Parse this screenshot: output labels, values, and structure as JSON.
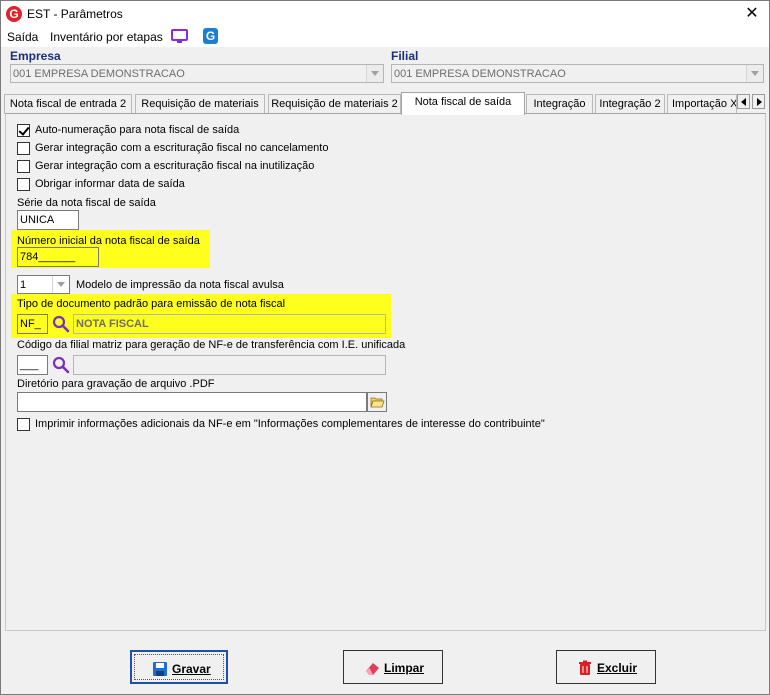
{
  "window": {
    "title": "EST - Parâmetros",
    "app_icon_letter": "G"
  },
  "menu": {
    "items": [
      "Saída",
      "Inventário por etapas"
    ],
    "g_icon_letter": "G"
  },
  "empresa": {
    "label": "Empresa",
    "value": "001 EMPRESA DEMONSTRACAO"
  },
  "filial": {
    "label": "Filial",
    "value": "001 EMPRESA DEMONSTRACAO"
  },
  "tabs": [
    "Nota fiscal de entrada 2",
    "Requisição de materiais",
    "Requisição de materiais 2",
    "Nota fiscal de saída",
    "Integração",
    "Integração 2",
    "Importação X"
  ],
  "active_tab": "Nota fiscal de saída",
  "checkboxes": [
    {
      "label": "Auto-numeração para nota fiscal de saída",
      "checked": true
    },
    {
      "label": "Gerar integração com a escrituração fiscal no cancelamento",
      "checked": false
    },
    {
      "label": "Gerar integração com a escrituração fiscal na inutilização",
      "checked": false
    },
    {
      "label": "Obrigar informar data de saída",
      "checked": false
    }
  ],
  "serie": {
    "label": "Série da nota fiscal de saída",
    "value": "UNICA"
  },
  "numero_inicial": {
    "label": "Número inicial da nota fiscal de saída",
    "value": "784______"
  },
  "modelo": {
    "value": "1",
    "label": "Modelo de impressão da nota fiscal avulsa"
  },
  "tipo_documento": {
    "label": "Tipo de documento padrão para emissão de nota fiscal",
    "code": "NF_",
    "description": "NOTA FISCAL"
  },
  "codigo_filial": {
    "label": "Código da filial matriz para geração de NF-e de transferência com I.E. unificada",
    "code": "___",
    "description": ""
  },
  "diretorio": {
    "label": "Diretório para gravação de arquivo .PDF",
    "value": ""
  },
  "imprimir_info": {
    "label": "Imprimir informações adicionais da NF-e em \"Informações complementares de interesse do contribuinte\"",
    "checked": false
  },
  "buttons": {
    "save": "Gravar",
    "clear": "Limpar",
    "delete": "Excluir"
  },
  "colors": {
    "highlight": "#ffff1e",
    "label_blue": "#1a2f7a",
    "search_purple": "#7b2fbe"
  }
}
